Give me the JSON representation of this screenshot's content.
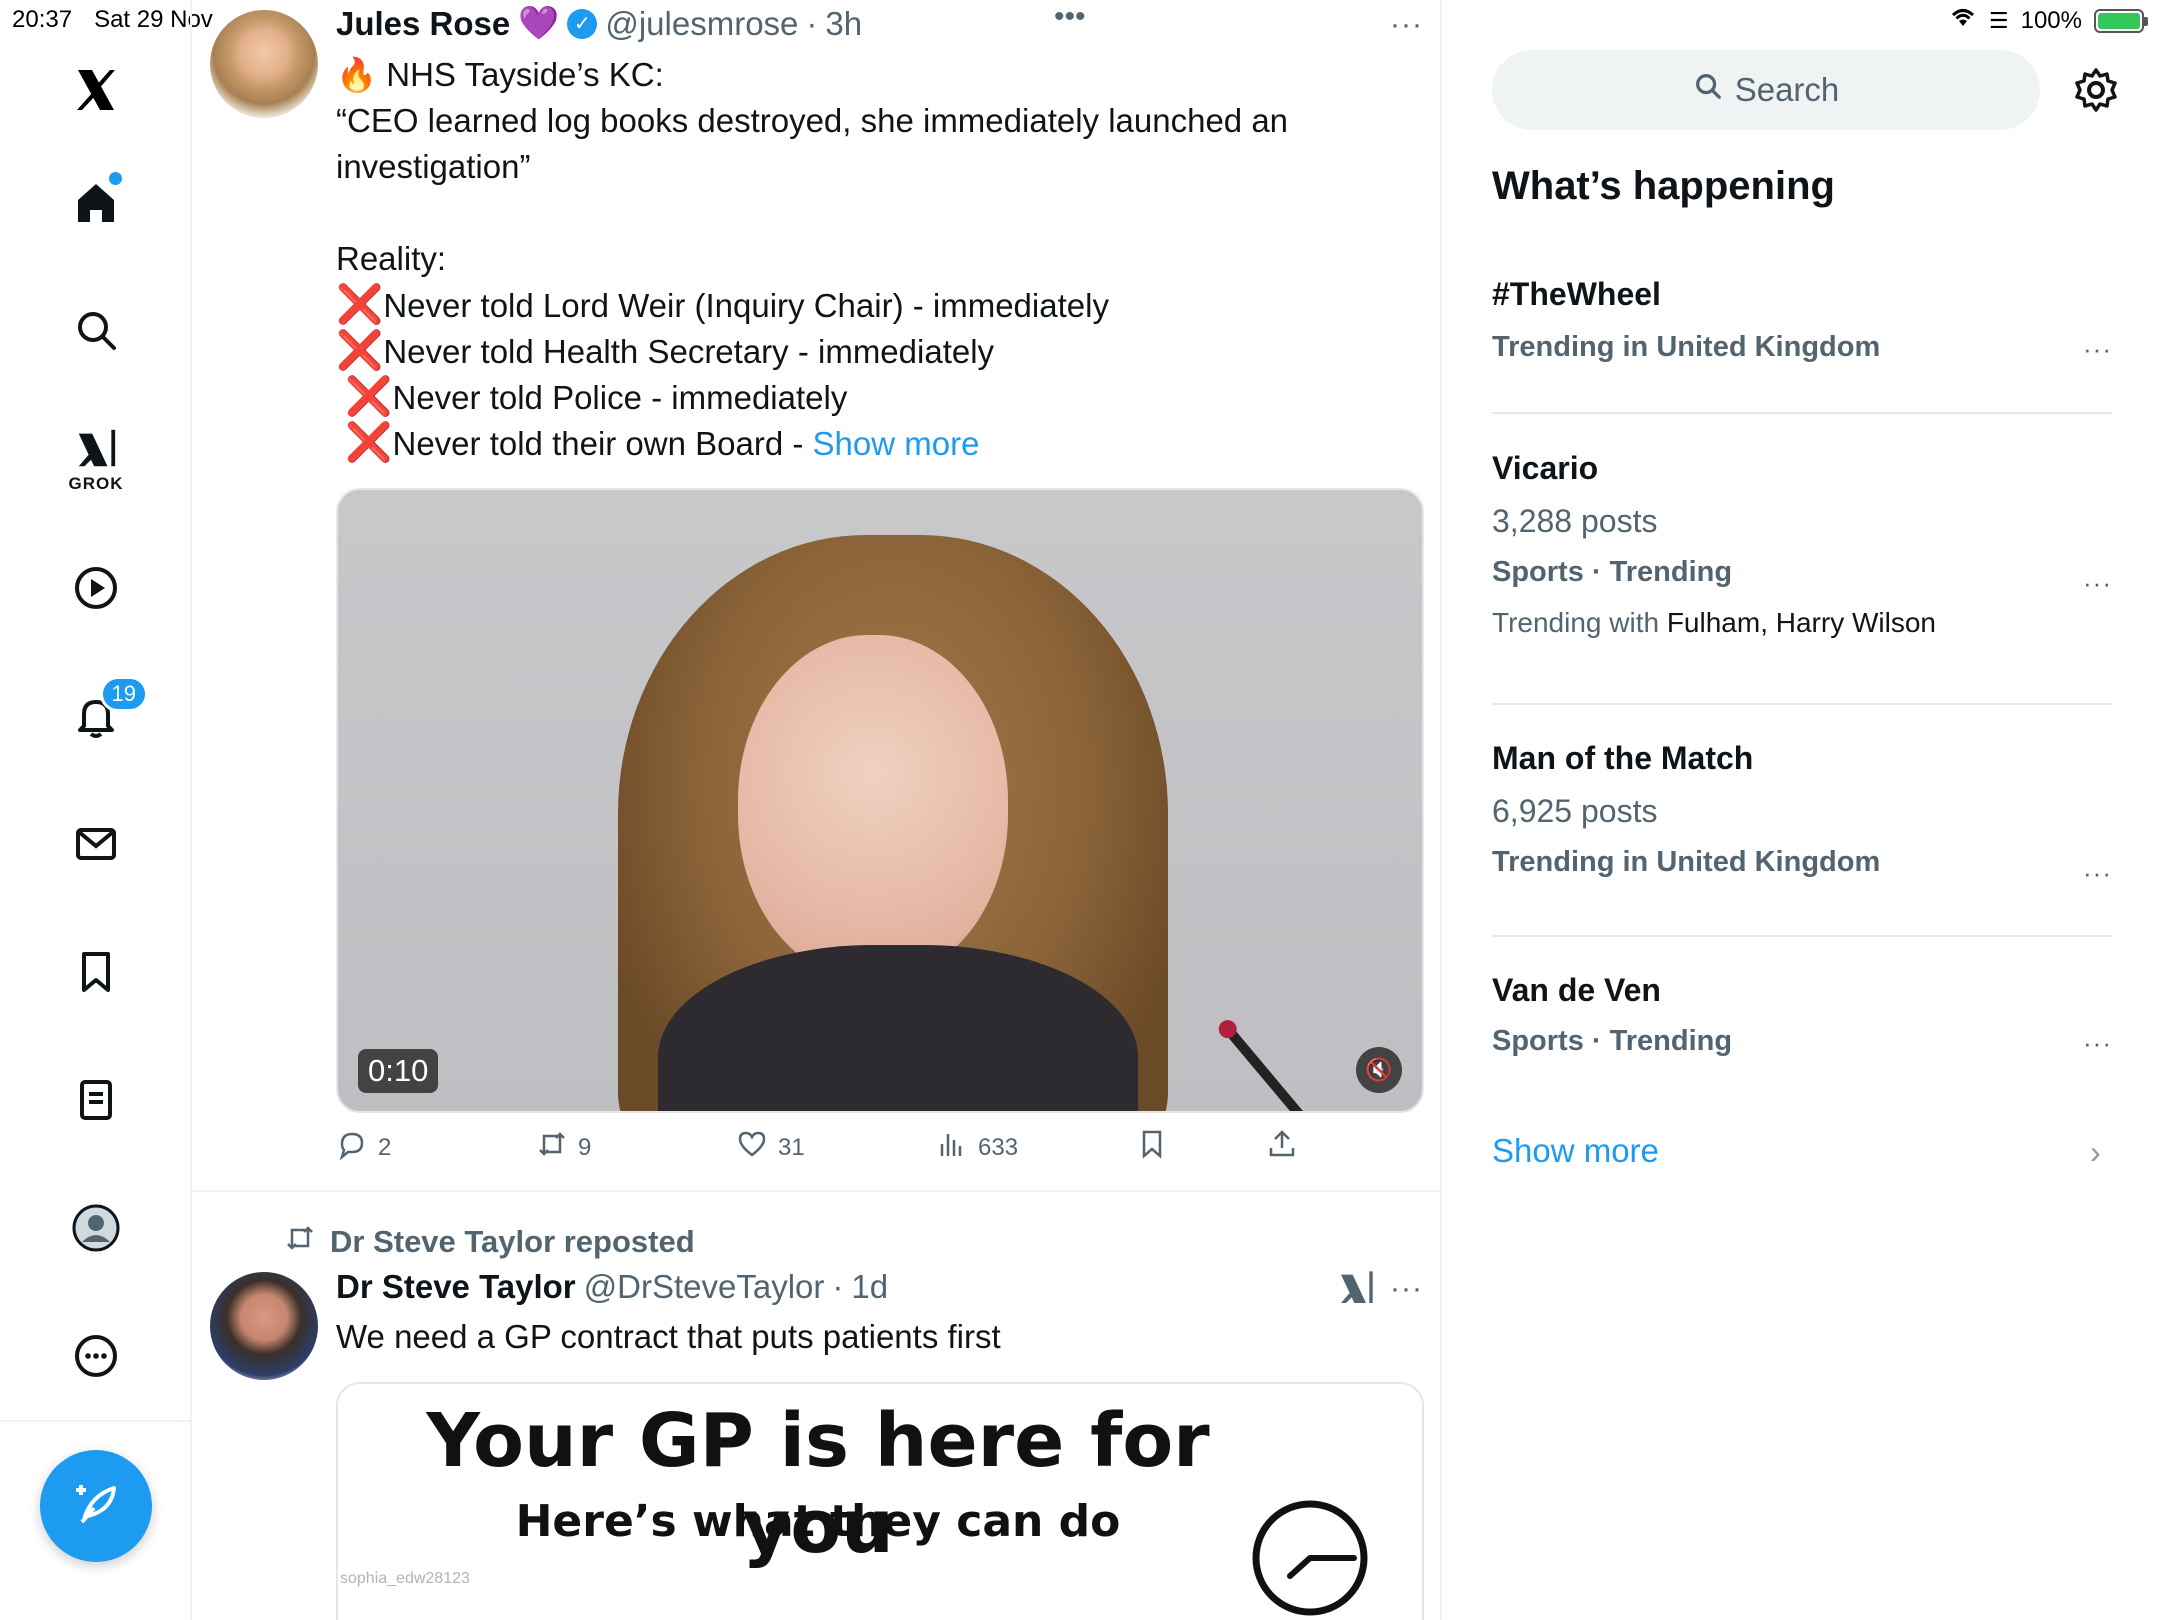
{
  "status_bar": {
    "time": "20:37",
    "date": "Sat 29 Nov",
    "battery": "100%"
  },
  "nav": {
    "logo": "X",
    "grok_label": "GROK",
    "notifications_badge": "19",
    "items": [
      "home-icon",
      "search-icon",
      "grok-icon",
      "video-icon",
      "bell-icon",
      "mail-icon",
      "bookmark-icon",
      "list-icon",
      "profile-icon",
      "more-icon",
      "compose-icon"
    ]
  },
  "feed": {
    "top_menu": "•••",
    "tweet1": {
      "name": "Jules Rose",
      "heart": "💜",
      "handle": "@julesmrose",
      "dot": "·",
      "time": "3h",
      "more": "···",
      "lines": [
        "🔥 NHS Tayside’s KC:",
        "“CEO learned log books destroyed, she immediately launched an",
        "investigation”",
        "",
        "Reality:",
        "Never told Lord Weir (Inquiry Chair) - immediately",
        "Never told Health Secretary - immediately",
        "Never told Police - immediately",
        "Never told their own Board - "
      ],
      "xmark": "❌",
      "show_more": "Show more",
      "video_duration": "0:10",
      "replies": "2",
      "reposts": "9",
      "likes": "31",
      "views": "633"
    },
    "tweet2": {
      "repost_label": "Dr Steve Taylor reposted",
      "name": "Dr Steve Taylor",
      "handle": "@DrSteveTaylor",
      "dot": "·",
      "time": "1d",
      "more": "···",
      "text": "We need a GP contract that puts patients first",
      "image_title": "Your GP is here for you",
      "image_subtitle": "Here’s what they can do",
      "image_watermark": "sophia_edw28123"
    }
  },
  "sidebar": {
    "search_placeholder": "Search",
    "title": "What’s happening",
    "trends": [
      {
        "name": "#TheWheel",
        "meta": "Trending in United Kingdom"
      },
      {
        "name": "Vicario",
        "posts": "3,288 posts",
        "meta": "Sports · Trending",
        "with_label": "Trending with",
        "with_names": "Fulham, Harry Wilson"
      },
      {
        "name": "Man of the Match",
        "posts": "6,925 posts",
        "meta": "Trending in United Kingdom"
      },
      {
        "name": "Van de Ven",
        "meta": "Sports · Trending"
      }
    ],
    "trend_more": "···",
    "show_more": "Show more"
  },
  "colors": {
    "accent": "#1d9bf0",
    "text": "#0f1419",
    "muted": "#536471",
    "xmark": "#e0201e"
  }
}
